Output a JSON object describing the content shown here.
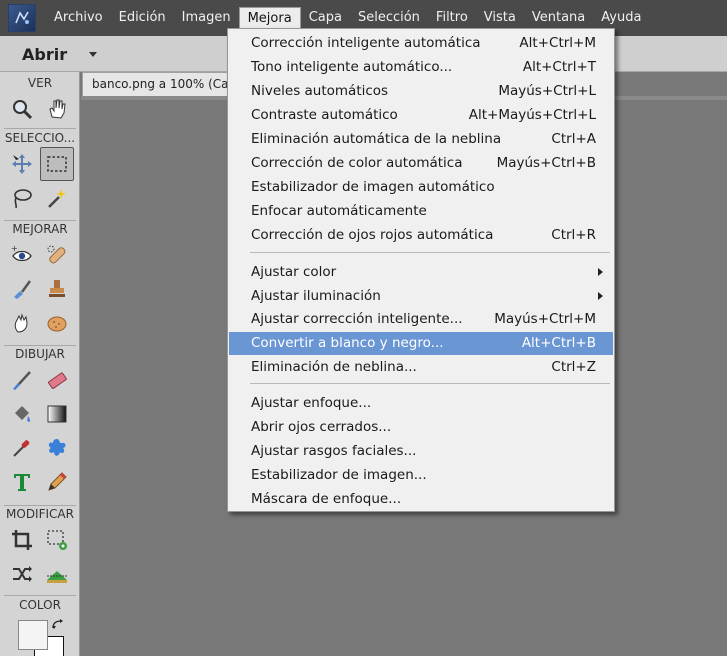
{
  "menubar": {
    "items": [
      "Archivo",
      "Edición",
      "Imagen",
      "Mejora",
      "Capa",
      "Selección",
      "Filtro",
      "Vista",
      "Ventana",
      "Ayuda"
    ],
    "active_index": 3
  },
  "optionbar": {
    "open_label": "Abrir"
  },
  "document": {
    "tab_title": "banco.png a 100% (Capa"
  },
  "toolbox": {
    "sections": {
      "ver": "VER",
      "seleccion": "SELECCIO...",
      "mejorar": "MEJORAR",
      "dibujar": "DIBUJAR",
      "modificar": "MODIFICAR",
      "color": "COLOR"
    }
  },
  "dropdown": {
    "groups": [
      [
        {
          "label": "Corrección inteligente automática",
          "shortcut": "Alt+Ctrl+M"
        },
        {
          "label": "Tono inteligente automático...",
          "shortcut": "Alt+Ctrl+T"
        },
        {
          "label": "Niveles automáticos",
          "shortcut": "Mayús+Ctrl+L"
        },
        {
          "label": "Contraste automático",
          "shortcut": "Alt+Mayús+Ctrl+L"
        },
        {
          "label": "Eliminación automática de la neblina",
          "shortcut": "Ctrl+A"
        },
        {
          "label": "Corrección de color automática",
          "shortcut": "Mayús+Ctrl+B"
        },
        {
          "label": "Estabilizador de imagen automático",
          "shortcut": ""
        },
        {
          "label": "Enfocar automáticamente",
          "shortcut": ""
        },
        {
          "label": "Corrección de ojos rojos automática",
          "shortcut": "Ctrl+R"
        }
      ],
      [
        {
          "label": "Ajustar color",
          "shortcut": "",
          "submenu": true
        },
        {
          "label": "Ajustar iluminación",
          "shortcut": "",
          "submenu": true
        },
        {
          "label": "Ajustar corrección inteligente...",
          "shortcut": "Mayús+Ctrl+M"
        },
        {
          "label": "Convertir a blanco y negro...",
          "shortcut": "Alt+Ctrl+B",
          "highlighted": true
        },
        {
          "label": "Eliminación de neblina...",
          "shortcut": "Ctrl+Z"
        }
      ],
      [
        {
          "label": "Ajustar enfoque...",
          "shortcut": ""
        },
        {
          "label": "Abrir ojos cerrados...",
          "shortcut": ""
        },
        {
          "label": "Ajustar rasgos faciales...",
          "shortcut": ""
        },
        {
          "label": "Estabilizador de imagen...",
          "shortcut": ""
        },
        {
          "label": "Máscara de enfoque...",
          "shortcut": ""
        }
      ]
    ]
  },
  "colors": {
    "menubar_bg": "#4a4a4a",
    "highlight": "#6a96d4",
    "canvas_bg": "#787878"
  }
}
